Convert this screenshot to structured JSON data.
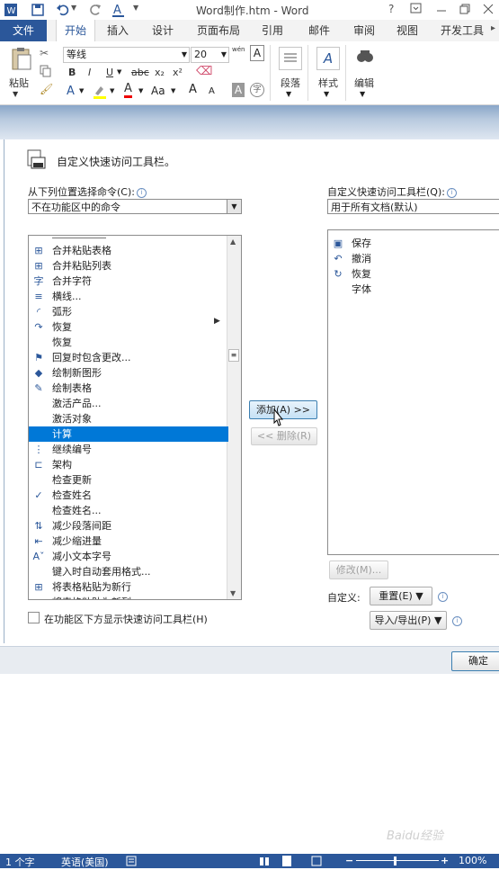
{
  "window": {
    "title": "Word制作.htm - Word",
    "help": "?"
  },
  "ribbon_tabs": [
    "文件",
    "开始",
    "插入",
    "设计",
    "页面布局",
    "引用",
    "邮件",
    "审阅",
    "视图",
    "开发工具"
  ],
  "ribbon": {
    "paste_label": "粘贴",
    "font_name": "等线",
    "font_size": "20",
    "paragraph_label": "段落",
    "styles_label": "样式",
    "editing_label": "编辑",
    "wen_glyph": "wén",
    "char_border_glyph": "A",
    "format_buttons": [
      "B",
      "I",
      "U",
      "abc",
      "x₂",
      "x²"
    ],
    "font_row2": [
      "A",
      "A",
      "Aa",
      "A",
      "A",
      "A",
      "字"
    ]
  },
  "dialog": {
    "section_title": "自定义快速访问工具栏。",
    "choose_label": "从下列位置选择命令(C):",
    "choose_value": "不在功能区中的命令",
    "customize_label": "自定义快速访问工具栏(Q):",
    "customize_value": "用于所有文档(默认)",
    "commands": [
      {
        "icon": "table-merge-icon",
        "glyph": "⊞",
        "label": "合并粘贴表格"
      },
      {
        "icon": "table-merge-icon",
        "glyph": "⊞",
        "label": "合并粘贴列表"
      },
      {
        "icon": "merge-chars-icon",
        "glyph": "字",
        "label": "合并字符"
      },
      {
        "icon": "horizontal-line-icon",
        "glyph": "≡",
        "label": "横线..."
      },
      {
        "icon": "arc-icon",
        "glyph": "◜",
        "label": "弧形"
      },
      {
        "icon": "redo-icon",
        "glyph": "↷",
        "label": "恢复"
      },
      {
        "icon": "",
        "glyph": "",
        "label": "恢复"
      },
      {
        "icon": "reply-changes-icon",
        "glyph": "⚑",
        "label": "回复时包含更改..."
      },
      {
        "icon": "draw-shape-icon",
        "glyph": "◆",
        "label": "绘制新图形"
      },
      {
        "icon": "draw-table-icon",
        "glyph": "✎",
        "label": "绘制表格"
      },
      {
        "icon": "",
        "glyph": "",
        "label": "激活产品..."
      },
      {
        "icon": "",
        "glyph": "",
        "label": "激活对象"
      },
      {
        "icon": "",
        "glyph": "",
        "label": "计算"
      },
      {
        "icon": "continue-numbering-icon",
        "glyph": "⋮",
        "label": "继续编号"
      },
      {
        "icon": "structure-icon",
        "glyph": "⊏",
        "label": "架构"
      },
      {
        "icon": "",
        "glyph": "",
        "label": "检查更新"
      },
      {
        "icon": "check-names-icon",
        "glyph": "✓",
        "label": "检查姓名"
      },
      {
        "icon": "",
        "glyph": "",
        "label": "检查姓名..."
      },
      {
        "icon": "decrease-spacing-icon",
        "glyph": "⇅",
        "label": "减少段落间距"
      },
      {
        "icon": "decrease-indent-icon",
        "glyph": "⇤",
        "label": "减少缩进量"
      },
      {
        "icon": "shrink-font-icon",
        "glyph": "Aˇ",
        "label": "减小文本字号"
      },
      {
        "icon": "",
        "glyph": "",
        "label": "键入时自动套用格式..."
      },
      {
        "icon": "table-rows-icon",
        "glyph": "⊞",
        "label": "将表格粘贴为新行"
      },
      {
        "icon": "table-cols-icon",
        "glyph": "⊞",
        "label": "将表格粘贴为新列"
      }
    ],
    "selected_index": 12,
    "qat_items": [
      {
        "icon": "save-icon",
        "glyph": "▣",
        "label": "保存"
      },
      {
        "icon": "undo-icon",
        "glyph": "↶",
        "label": "撤消"
      },
      {
        "icon": "redo-icon",
        "glyph": "↻",
        "label": "恢复"
      },
      {
        "icon": "",
        "glyph": "",
        "label": "字体"
      }
    ],
    "add_button": "添加(A) >>",
    "remove_button": "<< 删除(R)",
    "modify_button": "修改(M)...",
    "customize_text": "自定义:",
    "reset_button": "重置(E) ▼",
    "import_export_button": "导入/导出(P) ▼",
    "show_below_label": "在功能区下方显示快速访问工具栏(H)",
    "ok_button": "确定"
  },
  "status": {
    "words": "1 个字",
    "language": "英语(美国)",
    "zoom": "100%",
    "watermark": "Baidu经验"
  }
}
